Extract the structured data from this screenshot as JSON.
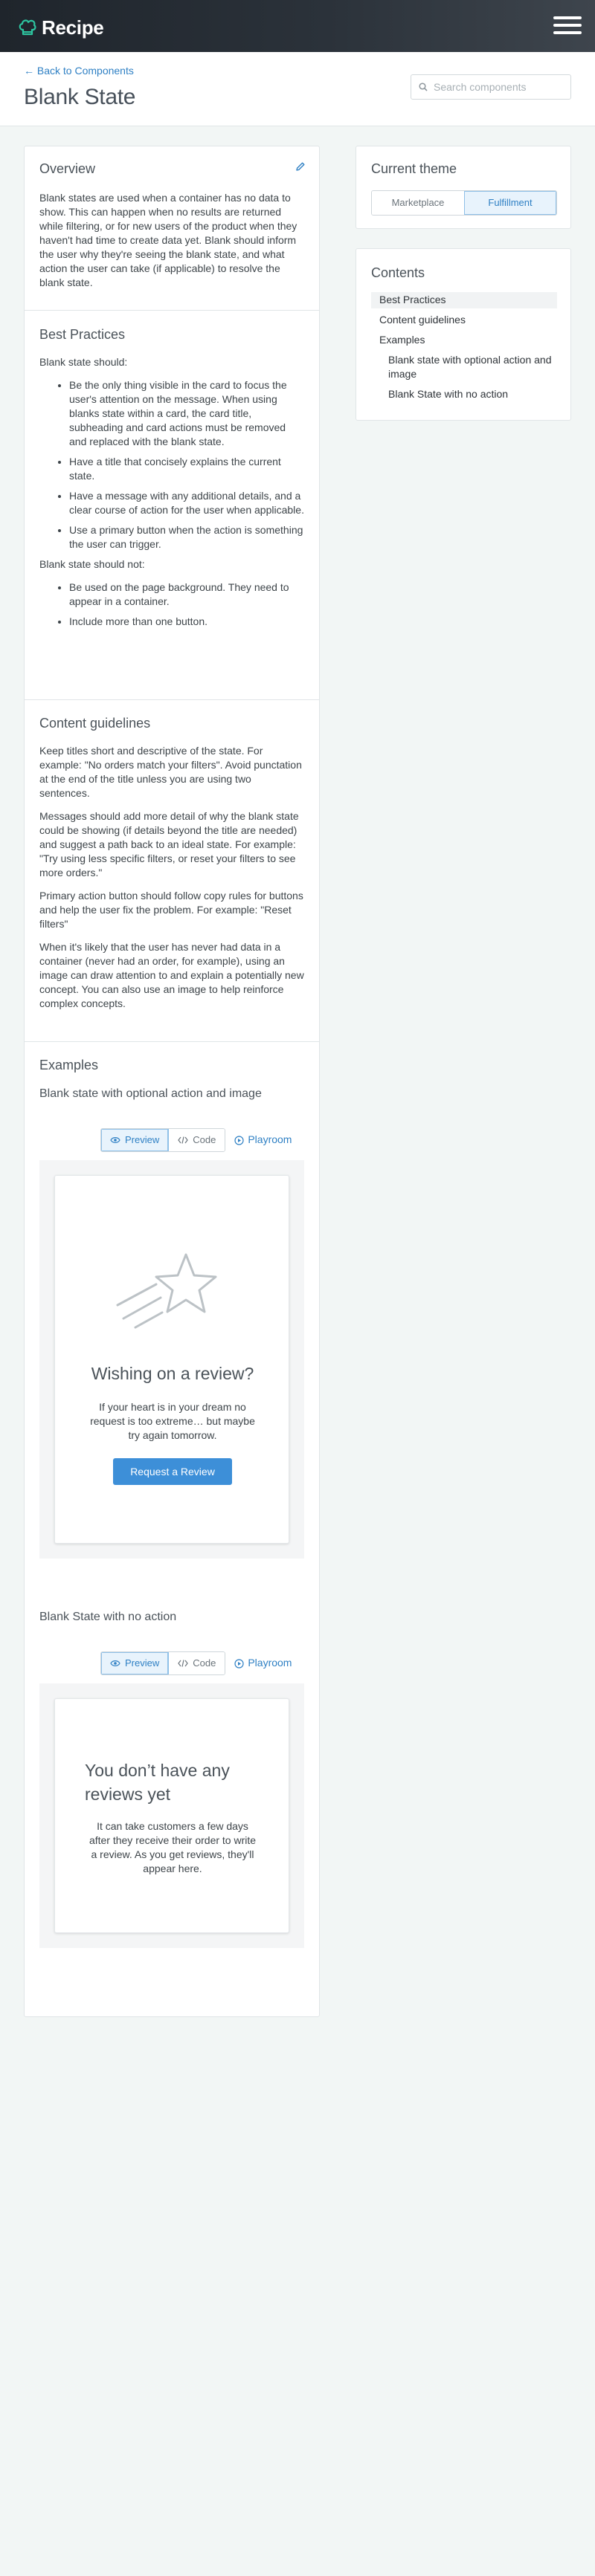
{
  "app": {
    "name": "Recipe"
  },
  "header": {
    "back_link": "← Back to Components",
    "page_title": "Blank State",
    "search_placeholder": "Search components"
  },
  "overview": {
    "heading": "Overview",
    "body": "Blank states are used when a container has no data to show. This can happen when no results are returned while filtering, or for new users of the product when they haven't had time to create data yet. Blank should inform the user why they're seeing the blank state, and what action the user can take (if applicable) to resolve the blank state."
  },
  "best_practices": {
    "heading": "Best Practices",
    "should_intro": "Blank state should:",
    "should": [
      "Be the only thing visible in the card to focus the user's attention on the message. When using blanks state within a card, the card title, subheading and card actions must be removed and replaced with the blank state.",
      "Have a title that concisely explains the current state.",
      "Have a message with any additional details, and a clear course of action for the user when applicable.",
      "Use a primary button when the action is something the user can trigger."
    ],
    "should_not_intro": "Blank state should not:",
    "should_not": [
      "Be used on the page background. They need to appear in a container.",
      "Include more than one button."
    ]
  },
  "content_guidelines": {
    "heading": "Content guidelines",
    "paragraphs": [
      "Keep titles short and descriptive of the state. For example: \"No orders match your filters\". Avoid punctation at the end of the title unless you are using two sentences.",
      "Messages should add more detail of why the blank state could be showing (if details beyond the title are needed) and suggest a path back to an ideal state. For example: \"Try using less specific filters, or reset your filters to see more orders.\"",
      "Primary action button should follow copy rules for buttons and help the user fix the problem. For example: \"Reset filters\"",
      "When it's likely that the user has never had data in a container (never had an order, for example), using an image can draw attention to and explain a potentially new concept. You can also use an image to help reinforce complex concepts."
    ]
  },
  "examples": {
    "heading": "Examples",
    "toolbar": {
      "preview": "Preview",
      "code": "Code",
      "playroom": "Playroom"
    },
    "example1": {
      "heading": "Blank state with optional action and image",
      "title": "Wishing on a review?",
      "message": "If your heart is in your dream no request is too extreme… but maybe try again tomorrow.",
      "button": "Request a Review"
    },
    "example2": {
      "heading": "Blank State with no action",
      "title": "You don’t have any reviews yet",
      "message": "It can take customers a few days after they receive their order to write a review. As you get reviews, they'll appear here."
    }
  },
  "theme": {
    "heading": "Current theme",
    "options": [
      "Marketplace",
      "Fulfillment"
    ],
    "selected": "Fulfillment"
  },
  "contents": {
    "heading": "Contents",
    "items": [
      "Best Practices",
      "Content guidelines",
      "Examples",
      "Blank state with optional action and image",
      "Blank State with no action"
    ]
  },
  "colors": {
    "accent": "#2f80c4",
    "button": "#3d8fd8",
    "brand_icon": "#2dc5a0",
    "header_bg": "#23292f"
  }
}
